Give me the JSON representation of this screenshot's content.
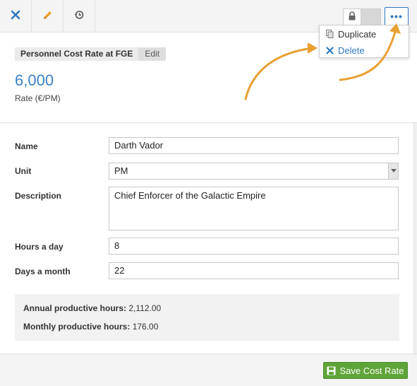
{
  "toolbar": {
    "icons": [
      "close-icon",
      "pencil-icon",
      "history-icon",
      "lock-icon",
      "more-icon"
    ],
    "more_label": "•••"
  },
  "menu": {
    "duplicate_label": "Duplicate",
    "delete_label": "Delete"
  },
  "header": {
    "title": "Personnel Cost Rate at FGE",
    "edit_label": "Edit",
    "value": "6,000",
    "value_label": "Rate (€/PM)"
  },
  "form": {
    "name_label": "Name",
    "name_value": "Darth Vador",
    "unit_label": "Unit",
    "unit_value": "PM",
    "description_label": "Description",
    "description_value": "Chief Enforcer of the Galactic Empire",
    "hours_label": "Hours a day",
    "hours_value": "8",
    "days_label": "Days a month",
    "days_value": "22"
  },
  "summary": {
    "annual_label": "Annual productive hours:",
    "annual_value": "2,112.00",
    "monthly_label": "Monthly productive hours:",
    "monthly_value": "176.00"
  },
  "footer": {
    "save_label": "Save Cost Rate"
  },
  "colors": {
    "accent": "#2e78c0",
    "save": "#5fa438",
    "arrow": "#e8a032",
    "edit_icon": "#e8a032"
  }
}
